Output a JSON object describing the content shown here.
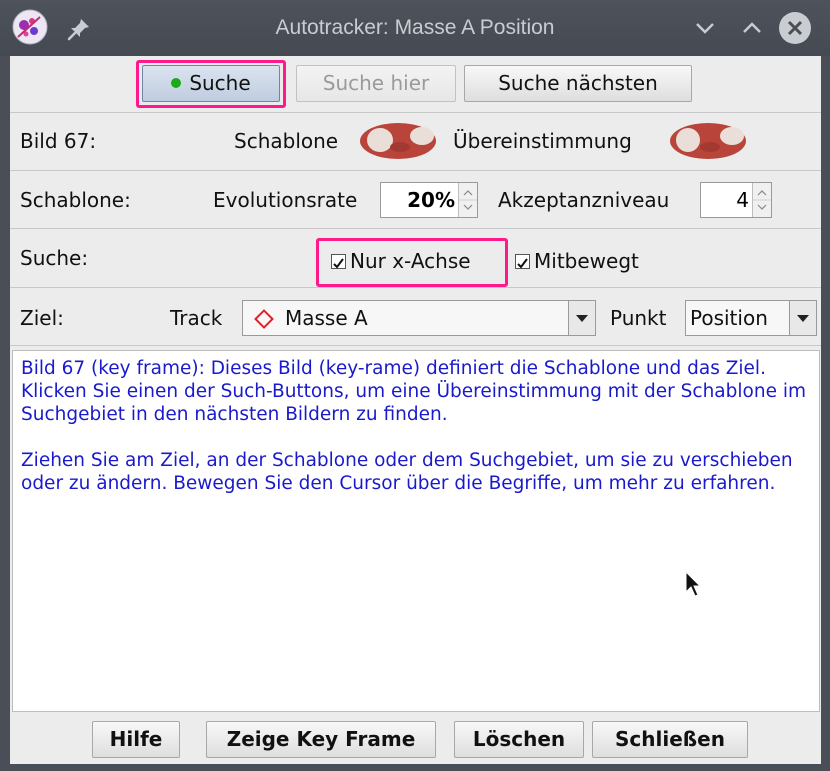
{
  "window": {
    "title": "Autotracker: Masse A Position"
  },
  "top_buttons": {
    "search": "Suche",
    "search_here": "Suche hier",
    "search_next": "Suche nächsten"
  },
  "frame_row": {
    "label": "Bild 67:",
    "template_label": "Schablone",
    "match_label": "Übereinstimmung"
  },
  "template_row": {
    "label": "Schablone:",
    "evolution_label": "Evolutionsrate",
    "evolution_value": "20%",
    "acceptance_label": "Akzeptanzniveau",
    "acceptance_value": "4"
  },
  "search_row": {
    "label": "Suche:",
    "x_axis_only": "Nur x-Achse",
    "x_axis_only_checked": true,
    "moving": "Mitbewegt",
    "moving_checked": true
  },
  "target_row": {
    "label": "Ziel:",
    "track_label": "Track",
    "track_value": "Masse A",
    "point_label": "Punkt",
    "point_value": "Position"
  },
  "info": {
    "paragraph1": "Bild 67 (key frame): Dieses Bild (key-rame) definiert die Schablone und das Ziel. Klicken Sie einen der Such-Buttons, um eine Übereinstimmung mit der Schablone im Suchgebiet in den nächsten Bildern zu finden.",
    "paragraph2": "Ziehen Sie am Ziel, an der Schablone oder dem Suchgebiet, um sie zu verschieben oder zu ändern. Bewegen Sie den Cursor über die Begriffe, um mehr zu erfahren."
  },
  "bottom_buttons": {
    "help": "Hilfe",
    "show_key_frame": "Zeige Key Frame",
    "delete": "Löschen",
    "close": "Schließen"
  },
  "colors": {
    "highlight": "#ff1a8c",
    "info_text": "#1a1acc",
    "status_dot": "#1aaa1a",
    "track_marker": "#e0202a"
  }
}
